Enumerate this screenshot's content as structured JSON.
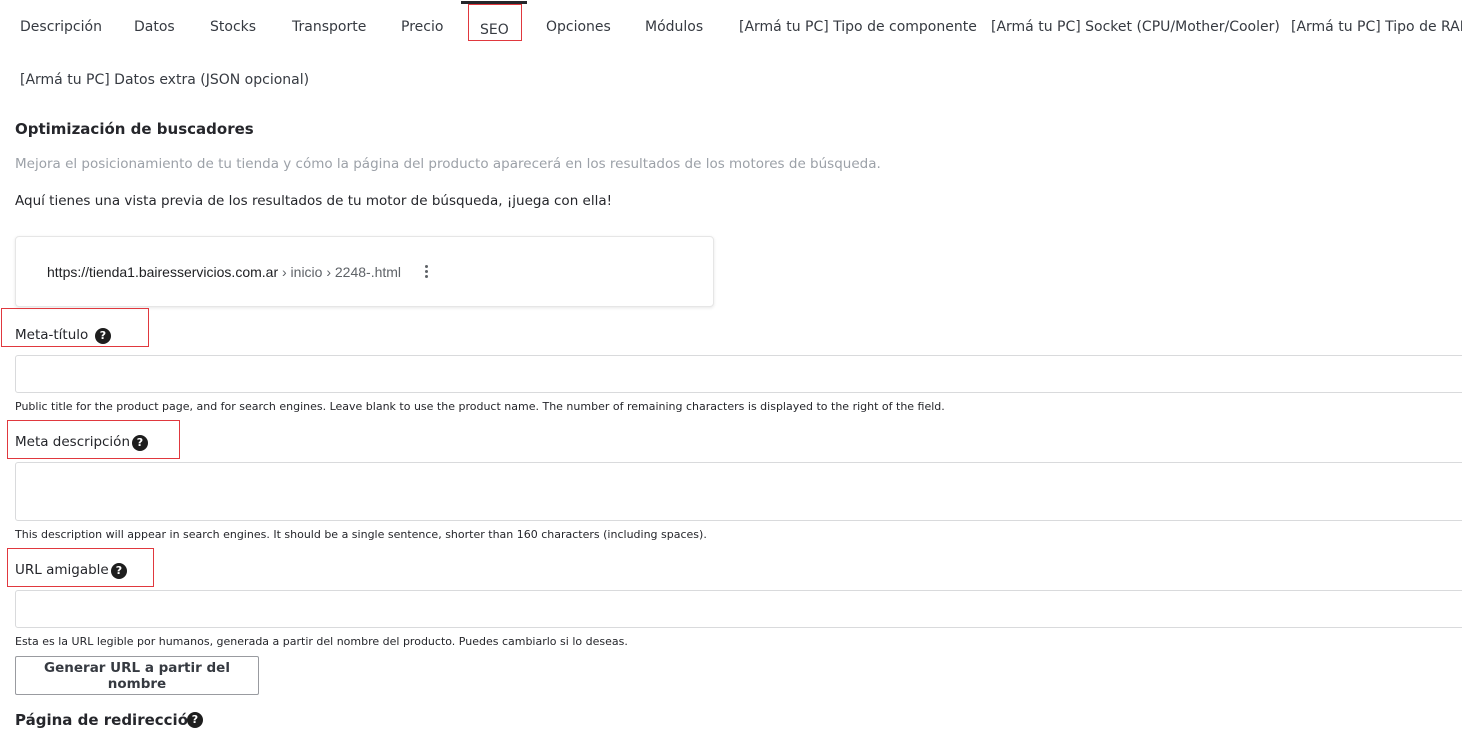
{
  "tabs": [
    {
      "label": "Descripción"
    },
    {
      "label": "Datos"
    },
    {
      "label": "Stocks"
    },
    {
      "label": "Transporte"
    },
    {
      "label": "Precio"
    },
    {
      "label": "SEO",
      "active": true
    },
    {
      "label": "Opciones"
    },
    {
      "label": "Módulos"
    },
    {
      "label": "[Armá tu PC] Tipo de componente"
    },
    {
      "label": "[Armá tu PC] Socket (CPU/Mother/Cooler)"
    },
    {
      "label": "[Armá tu PC] Tipo de RAM"
    },
    {
      "label": "[Armá tu PC] Datos extra (JSON opcional)"
    }
  ],
  "seo": {
    "title": "Optimización de buscadores",
    "subtitle": "Mejora el posicionamiento de tu tienda y cómo la página del producto aparecerá en los resultados de los motores de búsqueda.",
    "intro": "Aquí tienes una vista previa de los resultados de tu motor de búsqueda, ¡juega con ella!",
    "preview": {
      "host": "https://tienda1.bairesservicios.com.ar",
      "path": " › inicio › 2248-.html",
      "menu_icon": "more-vert-icon"
    },
    "meta_title": {
      "label": "Meta-título",
      "value": "",
      "hint": "Public title for the product page, and for search engines. Leave blank to use the product name. The number of remaining characters is displayed to the right of the field."
    },
    "meta_description": {
      "label": "Meta descripción",
      "value": "",
      "hint": "This description will appear in search engines. It should be a single sentence, shorter than 160 characters (including spaces)."
    },
    "friendly_url": {
      "label": "URL amigable",
      "value": "",
      "hint": "Esta es la URL legible por humanos, generada a partir del nombre del producto. Puedes cambiarlo si lo deseas.",
      "button": "Generar URL a partir del nombre"
    },
    "redirect": {
      "title": "Página de redirección"
    },
    "help_icon": "?"
  },
  "colors": {
    "highlight": "#e0383e",
    "muted_text": "#9ca1a8",
    "text": "#25262b"
  }
}
